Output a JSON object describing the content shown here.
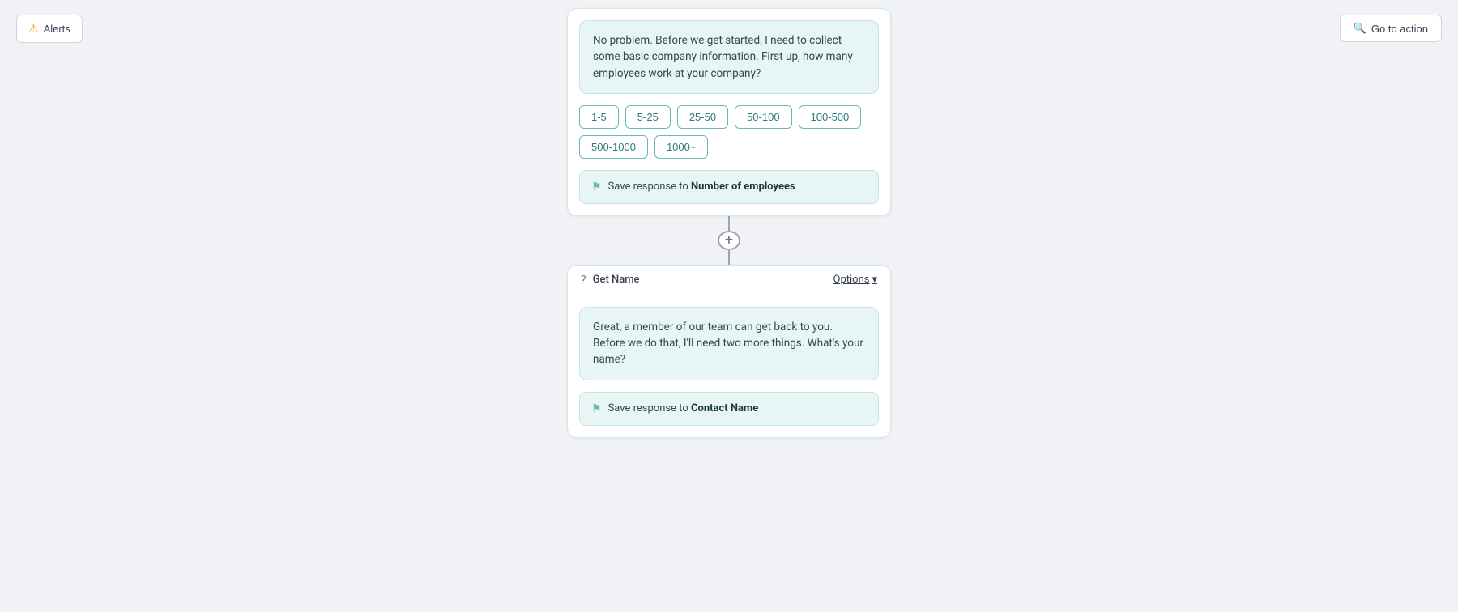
{
  "topBar": {
    "alertsLabel": "Alerts",
    "goToActionLabel": "Go to action"
  },
  "cards": [
    {
      "id": "card-employees",
      "headerTitle": null,
      "showHeader": false,
      "messageBubble": "No problem. Before we get started, I need to collect some basic company information. First up, how many employees work at your company?",
      "quickReplies": [
        "1-5",
        "5-25",
        "25-50",
        "50-100",
        "100-500",
        "500-1000",
        "1000+"
      ],
      "saveResponsePrefix": "Save response to ",
      "saveResponseField": "Number of employees"
    },
    {
      "id": "card-name",
      "headerTitle": "Get Name",
      "showHeader": true,
      "optionsLabel": "Options",
      "messageBubble": "Great, a member of our team can get back to you. Before we do that, I'll need two more things. What's your name?",
      "quickReplies": [],
      "saveResponsePrefix": "Save response to ",
      "saveResponseField": "Contact Name"
    }
  ],
  "connector": {
    "addLabel": "+"
  },
  "icons": {
    "alertIcon": "⚠",
    "searchIcon": "🔍",
    "flagIcon": "⚑",
    "questionIcon": "?",
    "chevronDownIcon": "▾"
  }
}
